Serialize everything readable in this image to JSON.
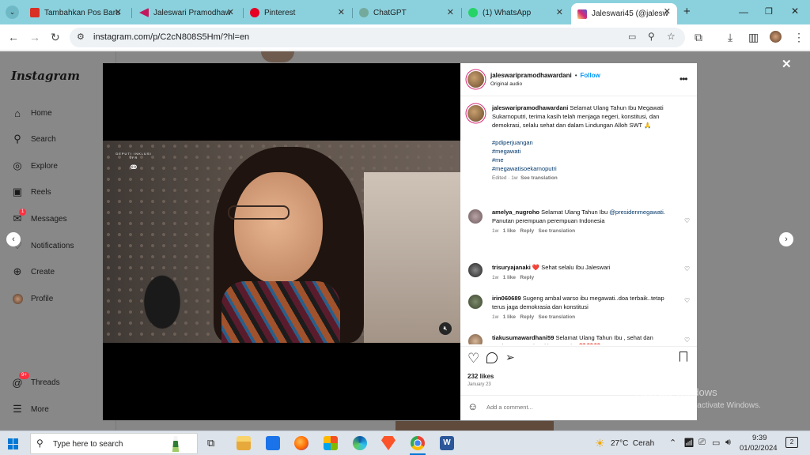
{
  "browser": {
    "tabs": [
      {
        "title": "Tambahkan Pos Baru",
        "color": "#d93025"
      },
      {
        "title": "Jaleswari Pramodhaw",
        "color": "#c2185b"
      },
      {
        "title": "Pinterest",
        "color": "#e60023"
      },
      {
        "title": "ChatGPT",
        "color": "#74aa9c"
      },
      {
        "title": "(1) WhatsApp",
        "color": "#25d366"
      },
      {
        "title": "Jaleswari45 (@jalesw",
        "color": "#d62976"
      }
    ],
    "new_tab_label": "+",
    "url": "instagram.com/p/C2cN808S5Hm/?hl=en"
  },
  "sidebar": {
    "logo": "Instagram",
    "items": [
      {
        "label": "Home",
        "icon": "home-icon",
        "glyph": "⌂"
      },
      {
        "label": "Search",
        "icon": "search-icon",
        "glyph": "⚲"
      },
      {
        "label": "Explore",
        "icon": "compass-icon",
        "glyph": "◎"
      },
      {
        "label": "Reels",
        "icon": "reels-icon",
        "glyph": "▣"
      },
      {
        "label": "Messages",
        "icon": "messenger-icon",
        "glyph": "✉",
        "badge": "1"
      },
      {
        "label": "Notifications",
        "icon": "heart-icon",
        "glyph": "♡"
      },
      {
        "label": "Create",
        "icon": "plus-square-icon",
        "glyph": "⊕"
      },
      {
        "label": "Profile",
        "icon": "avatar-icon",
        "glyph": "●"
      }
    ],
    "threads": {
      "label": "Threads",
      "badge": "9+"
    },
    "more": {
      "label": "More"
    }
  },
  "video": {
    "watermark_line1": "DEPUTI INKLUSI TFR",
    "mute_icon": "speaker-muted-icon"
  },
  "post": {
    "author": "jaleswaripramodhawardani",
    "follow": "Follow",
    "audio": "Original audio",
    "caption": "Selamat Ulang Tahun Ibu Megawati Sukarnoputri, terima kasih telah menjaga negeri, konstitusi, dan demokrasi, selalu sehat dan dalam Lindungan Alloh SWT 🙏",
    "hashtags": [
      "#pdiperjuangan",
      "#megawati",
      "#me",
      "#megawatisoekarnoputri"
    ],
    "caption_meta": {
      "edited": "Edited · 1w",
      "see_translation": "See translation"
    },
    "comments": [
      {
        "user": "amelya_nugroho",
        "text": "Selamat Ulang Tahun Ibu",
        "mention": "@presidenmegawati",
        "text2": ". Panutan perempuan perempuan Indonesia",
        "time": "1w",
        "likes": "1 like",
        "reply": "Reply",
        "translate": "See translation"
      },
      {
        "user": "trisuryajanaki",
        "text": "❤️ Sehat selalu Ibu Jaleswari",
        "time": "1w",
        "likes": "1 like",
        "reply": "Reply"
      },
      {
        "user": "irin060689",
        "text": "Sugeng ambal warso ibu megawati..doa terbaik..tetap terus jaga demokrasia dan konstitusi",
        "time": "1w",
        "likes": "1 like",
        "reply": "Reply",
        "translate": "See translation"
      },
      {
        "user": "tiakusumawardhani59",
        "text": "Selamat Ulang Tahun Ibu , sehat dan panjang umur , kami bangga Ibu ❤️❤️❤️"
      }
    ],
    "likes": "232 likes",
    "date": "January 23",
    "comment_placeholder": "Add a comment..."
  },
  "watermark": {
    "line1": "Activate Windows",
    "line2": "Go to Settings to activate Windows."
  },
  "taskbar": {
    "search_placeholder": "Type here to search",
    "weather": "27°C  Cerah",
    "time": "9:39",
    "date": "01/02/2024",
    "notif_count": "2"
  }
}
